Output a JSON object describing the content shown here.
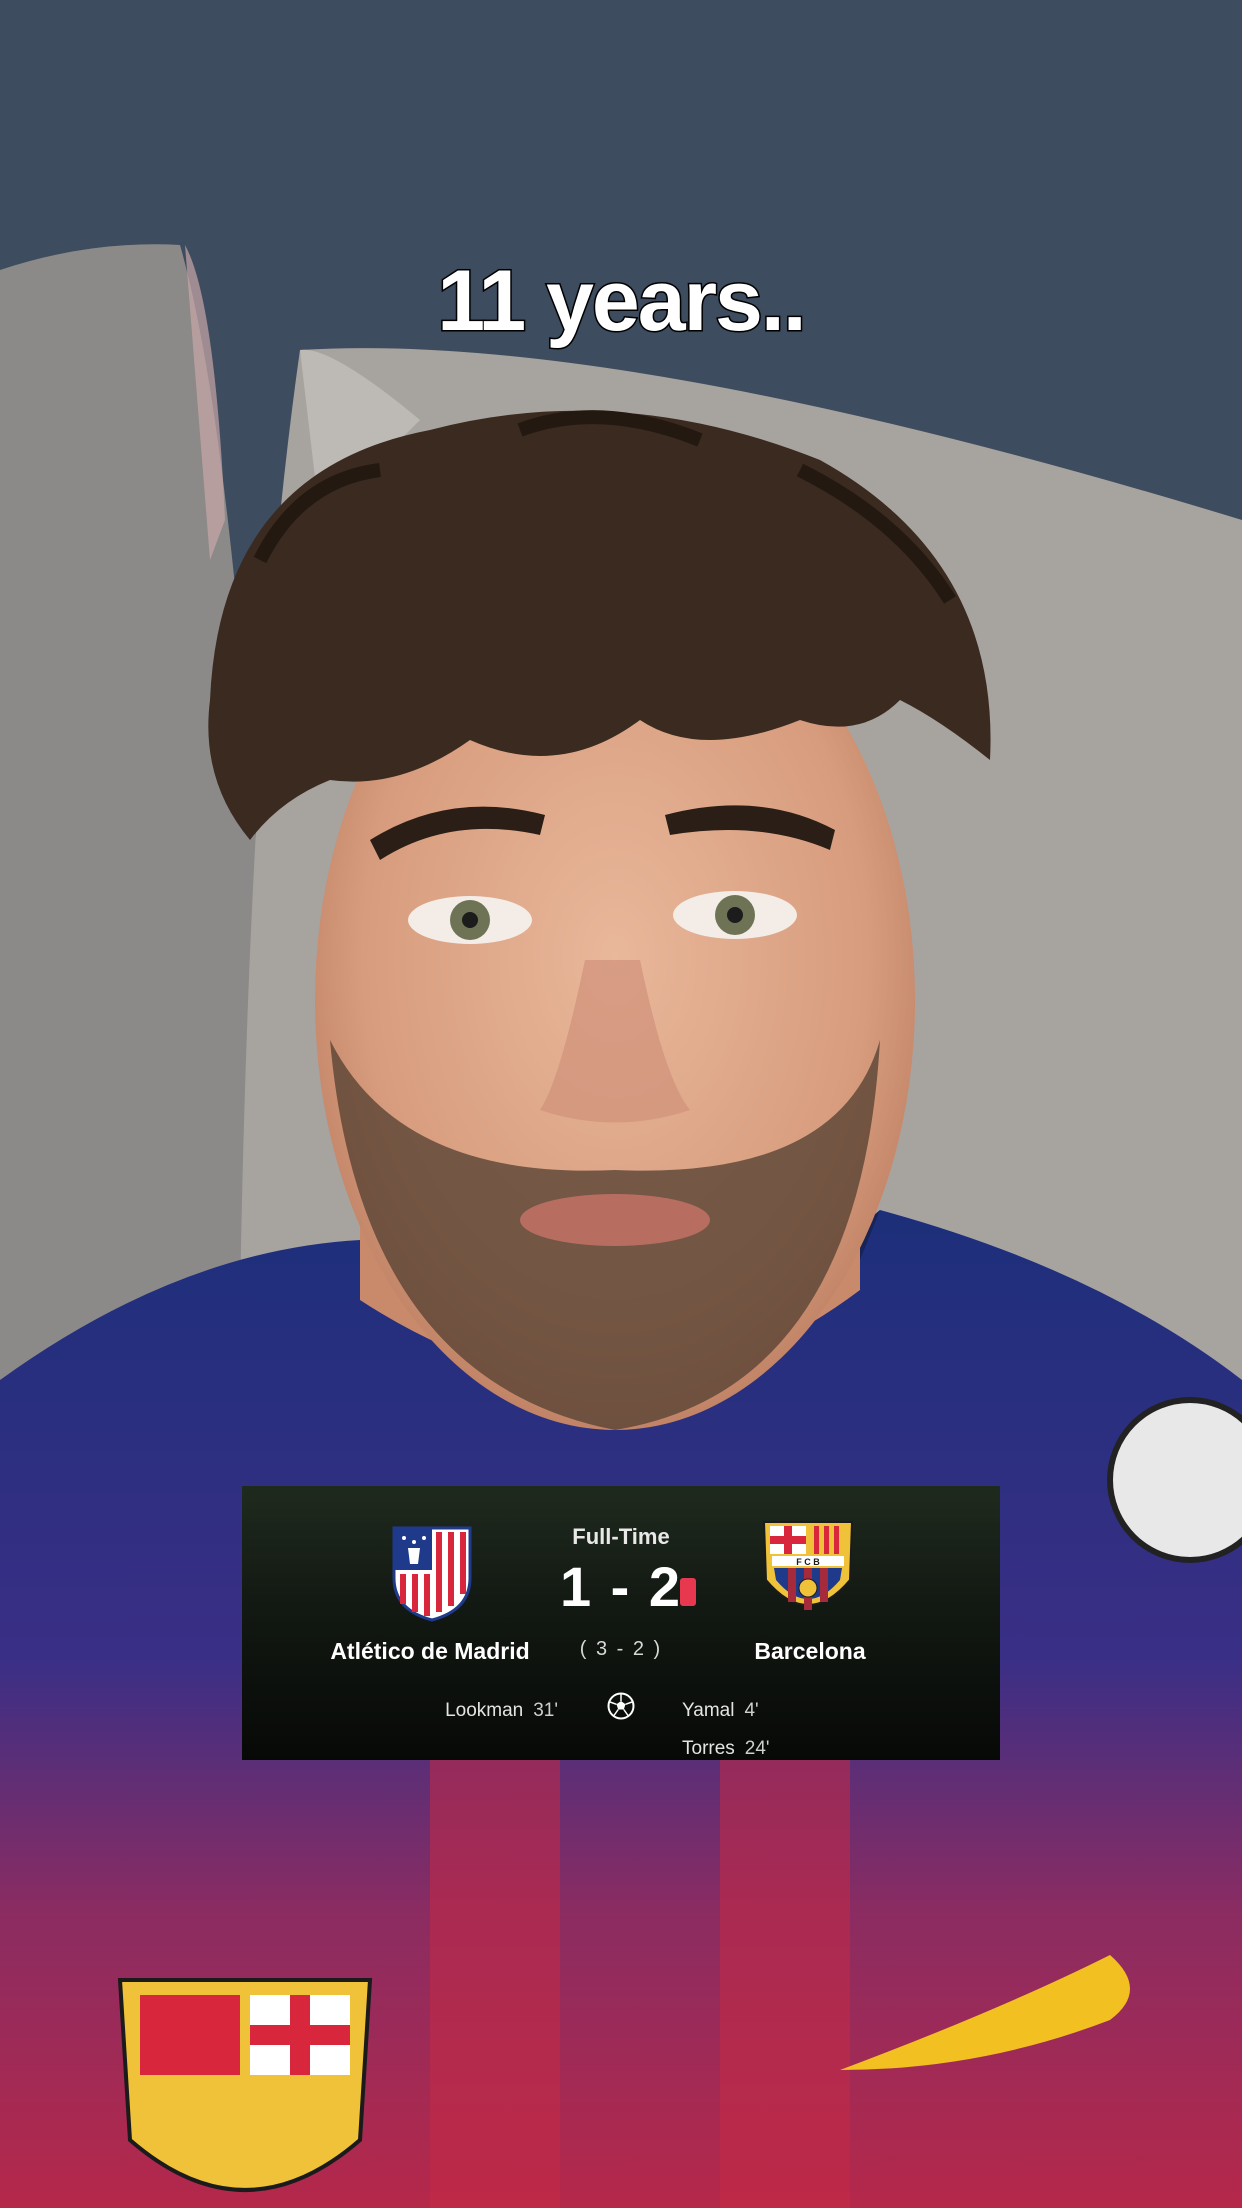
{
  "caption": "11 years..",
  "match": {
    "status": "Full-Time",
    "home": {
      "name": "Atlético de Madrid",
      "crest": "atletico-madrid-crest",
      "scorers": [
        {
          "name": "Lookman",
          "minute": "31'"
        }
      ]
    },
    "away": {
      "name": "Barcelona",
      "crest": "fc-barcelona-crest",
      "scorers": [
        {
          "name": "Yamal",
          "minute": "4'"
        },
        {
          "name": "Torres",
          "minute": "24'"
        }
      ]
    },
    "score": "1 - 2",
    "aggregate": "( 3 - 2 )",
    "red_card_icon": "red-card-icon",
    "goal_icon": "soccer-ball-icon",
    "colors": {
      "card_bg": "#0c110c",
      "red_card": "#e8384f"
    }
  }
}
